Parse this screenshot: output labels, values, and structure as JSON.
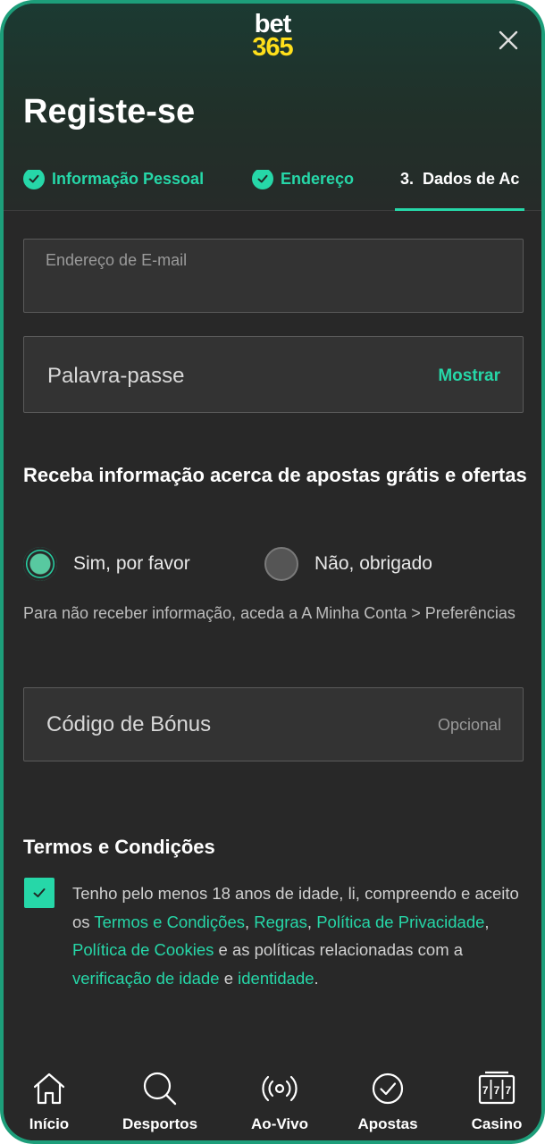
{
  "header": {
    "logo_line1": "bet",
    "logo_line2": "365",
    "title": "Registe-se"
  },
  "steps": [
    {
      "label": "Informação Pessoal",
      "state": "done"
    },
    {
      "label": "Endereço",
      "state": "done"
    },
    {
      "label": "3.  Dados de Ac",
      "state": "active"
    }
  ],
  "form": {
    "email_placeholder": "Endereço de E-mail",
    "password_placeholder": "Palavra-passe",
    "show_label": "Mostrar",
    "promo_heading": "Receba informação acerca de apostas grátis e ofertas",
    "radio_yes": "Sim, por favor",
    "radio_no": "Não, obrigado",
    "radio_selected": "yes",
    "note": "Para não receber informação, aceda a A Minha Conta > Preferências",
    "bonus_placeholder": "Código de Bónus",
    "bonus_optional": "Opcional"
  },
  "terms": {
    "heading": "Termos e Condições",
    "checked": true,
    "text_1": "Tenho pelo menos 18 anos de idade, li, compreendo e aceito os ",
    "link_terms": "Termos e Condições",
    "sep_1": ", ",
    "link_rules": "Regras",
    "sep_2": ", ",
    "link_privacy": "Política de Privacidade",
    "sep_3": ", ",
    "link_cookies": "Política de Cookies",
    "text_2": " e as políticas relacionadas com a ",
    "link_age": "verificação de idade",
    "text_3": " e ",
    "link_identity": "identidade",
    "text_4": "."
  },
  "nav": [
    {
      "label": "Início",
      "icon": "home-icon"
    },
    {
      "label": "Desportos",
      "icon": "search-icon"
    },
    {
      "label": "Ao-Vivo",
      "icon": "live-broadcast-icon"
    },
    {
      "label": "Apostas",
      "icon": "check-circle-icon"
    },
    {
      "label": "Casino",
      "icon": "slot-machine-icon"
    }
  ],
  "colors": {
    "accent": "#26d7a8",
    "brand_yellow": "#ffdf1b",
    "background": "#282828"
  }
}
